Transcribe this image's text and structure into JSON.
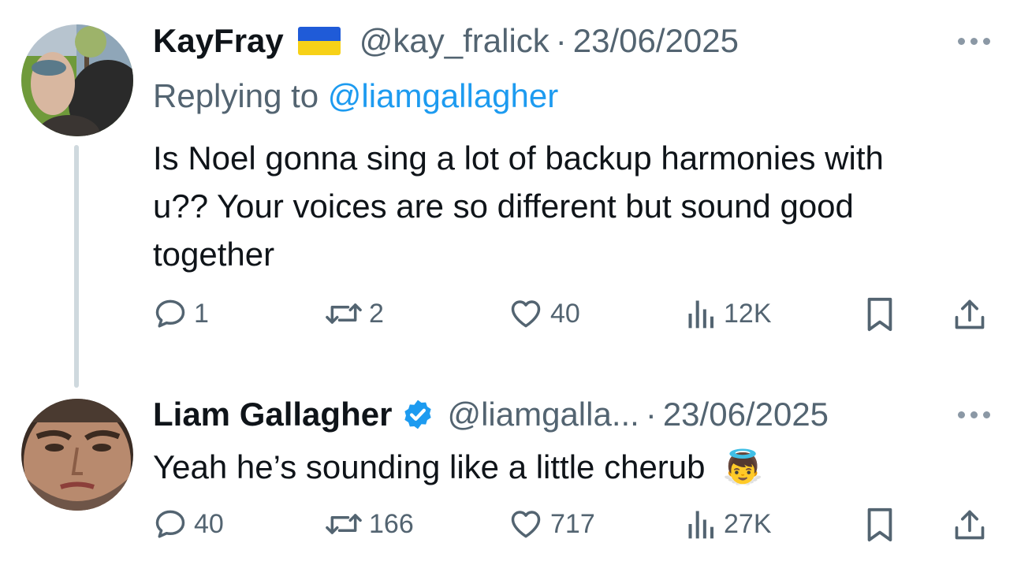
{
  "tweets": [
    {
      "author_name": "KayFray",
      "flag_icon": "ukraine-flag-icon",
      "handle": "@kay_fralick",
      "separator": "·",
      "date": "23/06/2025",
      "replying_prefix": "Replying to ",
      "replying_to": "@liamgallagher",
      "text_lines": [
        "Is Noel gonna sing a lot of backup harmonies with",
        "u??  Your voices are so different but sound good",
        "together"
      ],
      "replies": "1",
      "reposts": "2",
      "likes": "40",
      "views": "12K"
    },
    {
      "author_name": "Liam Gallagher",
      "verified_icon": "verified-badge-icon",
      "handle": "@liamgalla...",
      "separator": "·",
      "date": "23/06/2025",
      "text": "Yeah he’s sounding like a little cherub",
      "emoji": "👼",
      "replies": "40",
      "reposts": "166",
      "likes": "717",
      "views": "27K"
    }
  ],
  "colors": {
    "text": "#0f1419",
    "secondary": "#536471",
    "link": "#1d9bf0",
    "thread_line": "#cfd9de"
  }
}
